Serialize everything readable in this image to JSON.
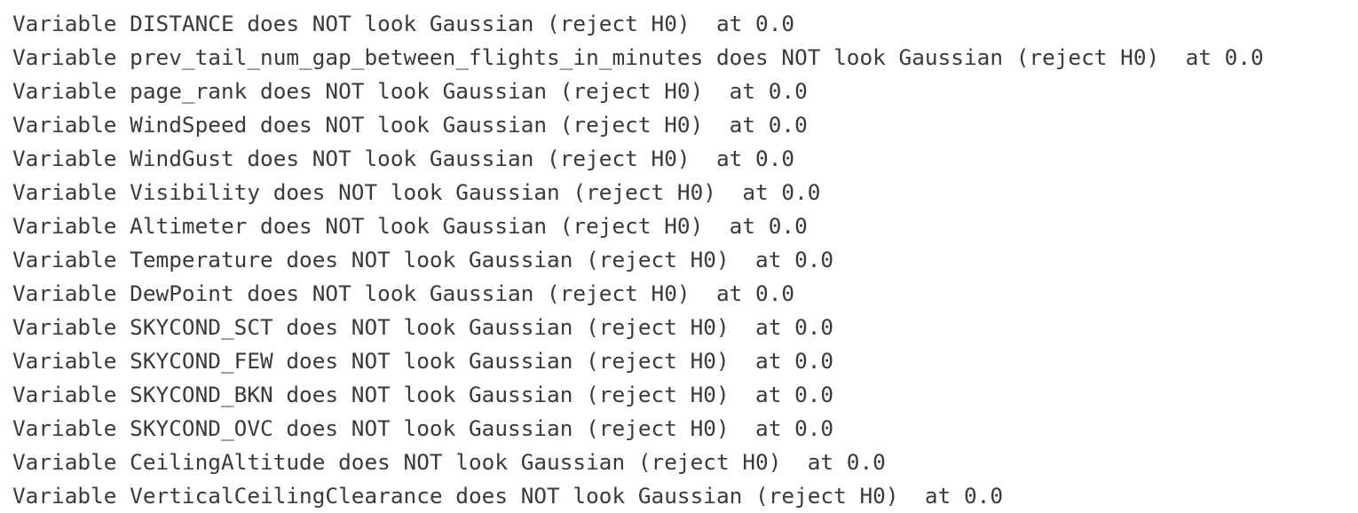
{
  "output": {
    "lines": [
      "Variable DISTANCE does NOT look Gaussian (reject H0)  at 0.0",
      "Variable prev_tail_num_gap_between_flights_in_minutes does NOT look Gaussian (reject H0)  at 0.0",
      "Variable page_rank does NOT look Gaussian (reject H0)  at 0.0",
      "Variable WindSpeed does NOT look Gaussian (reject H0)  at 0.0",
      "Variable WindGust does NOT look Gaussian (reject H0)  at 0.0",
      "Variable Visibility does NOT look Gaussian (reject H0)  at 0.0",
      "Variable Altimeter does NOT look Gaussian (reject H0)  at 0.0",
      "Variable Temperature does NOT look Gaussian (reject H0)  at 0.0",
      "Variable DewPoint does NOT look Gaussian (reject H0)  at 0.0",
      "Variable SKYCOND_SCT does NOT look Gaussian (reject H0)  at 0.0",
      "Variable SKYCOND_FEW does NOT look Gaussian (reject H0)  at 0.0",
      "Variable SKYCOND_BKN does NOT look Gaussian (reject H0)  at 0.0",
      "Variable SKYCOND_OVC does NOT look Gaussian (reject H0)  at 0.0",
      "Variable CeilingAltitude does NOT look Gaussian (reject H0)  at 0.0",
      "Variable VerticalCeilingClearance does NOT look Gaussian (reject H0)  at 0.0"
    ]
  },
  "colors": {
    "text": "#3a3a3a",
    "background": "#ffffff"
  }
}
